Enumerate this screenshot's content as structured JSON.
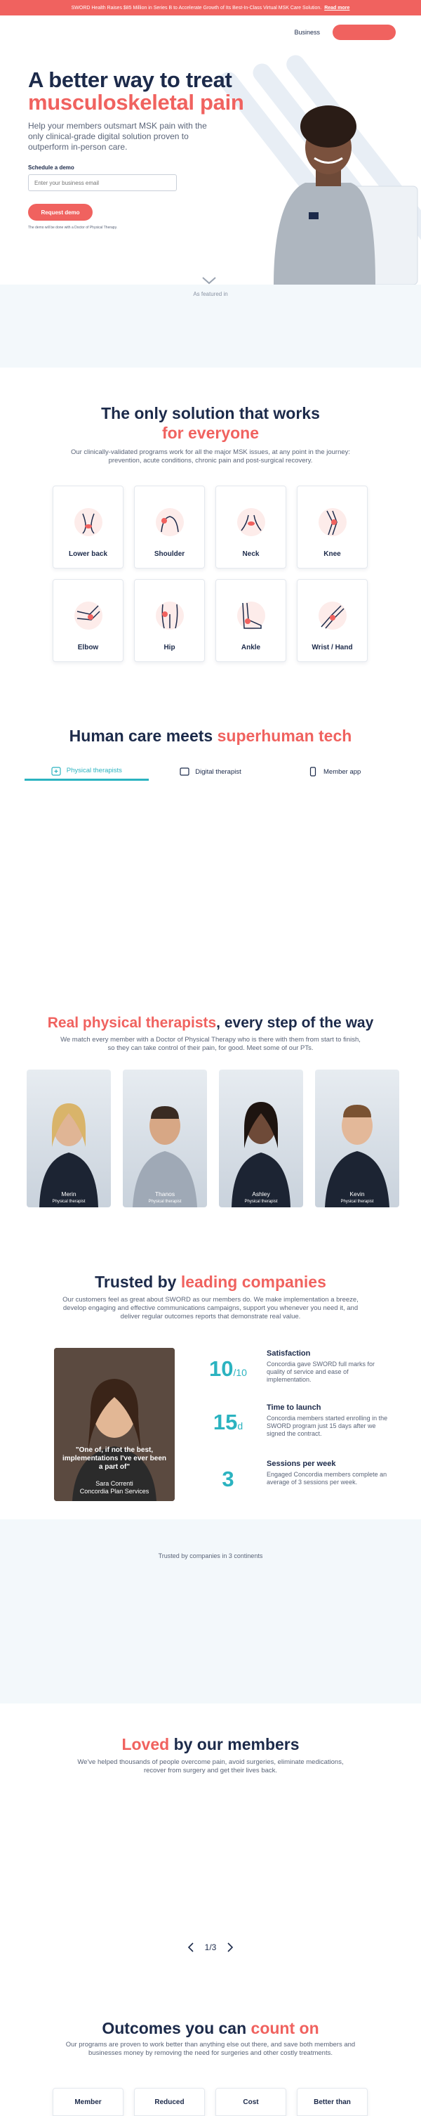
{
  "announcement": {
    "text": "SWORD Health Raises $85 Million in Series B to Accelerate Growth of Its Best-In-Class Virtual MSK Care Solution.",
    "link": "Read more",
    "bg": "#f0625f"
  },
  "header": {
    "business_link": "Business"
  },
  "hero": {
    "title_line1": "A better way to treat",
    "title_line2": "musculoskeletal pain",
    "subtitle": "Help your members outsmart MSK pain with the only clinical-grade digital solution proven to outperform in-person care.",
    "schedule_label": "Schedule a demo",
    "email_placeholder": "Enter your business email",
    "request_button": "Request demo",
    "fine_print": "The demo will be done with a Doctor of Physical Therapy."
  },
  "featured": {
    "label": "As featured in"
  },
  "solution": {
    "title_line1": "The only solution that works",
    "title_line2": "for everyone",
    "subtitle": "Our clinically-validated programs work for all the major MSK issues, at any point in the journey: prevention, acute conditions, chronic pain and post-surgical recovery.",
    "areas": [
      {
        "label": "Lower back",
        "icon": "lower-back-icon"
      },
      {
        "label": "Shoulder",
        "icon": "shoulder-icon"
      },
      {
        "label": "Neck",
        "icon": "neck-icon"
      },
      {
        "label": "Knee",
        "icon": "knee-icon"
      },
      {
        "label": "Elbow",
        "icon": "elbow-icon"
      },
      {
        "label": "Hip",
        "icon": "hip-icon"
      },
      {
        "label": "Ankle",
        "icon": "ankle-icon"
      },
      {
        "label": "Wrist / Hand",
        "icon": "wrist-hand-icon"
      }
    ]
  },
  "human_care": {
    "title_part1": "Human care meets ",
    "title_part2": "superhuman tech",
    "tabs": [
      {
        "label": "Physical therapists",
        "icon": "therapist-icon",
        "active": true
      },
      {
        "label": "Digital therapist",
        "icon": "tablet-icon",
        "active": false
      },
      {
        "label": "Member app",
        "icon": "phone-icon",
        "active": false
      }
    ],
    "accent": "#2bb3c0"
  },
  "therapists": {
    "title_part1": "Real physical therapists",
    "title_part2": ", every step of the way",
    "subtitle": "We match every member with a Doctor of Physical Therapy who is there with them from start to finish, so they can take control of their pain, for good. Meet some of our PTs.",
    "people": [
      {
        "name": "Merin",
        "role": "Physical therapist"
      },
      {
        "name": "Thanos",
        "role": "Physical therapist"
      },
      {
        "name": "Ashley",
        "role": "Physical therapist"
      },
      {
        "name": "Kevin",
        "role": "Physical therapist"
      }
    ]
  },
  "trusted": {
    "title_part1": "Trusted by ",
    "title_part2": "leading companies",
    "subtitle": "Our customers feel as great about SWORD as our members do. We make implementation a breeze, develop engaging and effective communications campaigns, support you whenever you need it, and deliver regular outcomes reports that demonstrate real value.",
    "quote": "\"One of, if not the best, implementations I've ever been a part of\"",
    "quote_name": "Sara Correnti",
    "quote_company": "Concordia Plan Services",
    "stats": [
      {
        "number": "10",
        "suffix": "/10",
        "title": "Satisfaction",
        "text": "Concordia gave SWORD full marks for quality of service and ease of implementation."
      },
      {
        "number": "15",
        "suffix": "d",
        "title": "Time to launch",
        "text": "Concordia members started enrolling in the SWORD program just 15 days after we signed the contract."
      },
      {
        "number": "3",
        "suffix": "",
        "title": "Sessions per week",
        "text": "Engaged Concordia members complete an average of 3 sessions per week."
      }
    ],
    "band_label": "Trusted by companies in 3 continents"
  },
  "members": {
    "title_part1": "Loved",
    "title_part2": " by our members",
    "subtitle": "We've helped thousands of people overcome pain, avoid surgeries, eliminate medications, recover from surgery and get their lives back.",
    "pager": "1/3"
  },
  "outcomes": {
    "title_part1": "Outcomes you can ",
    "title_part2": "count on",
    "subtitle": "Our programs are proven to work better than anything else out there, and save both members and businesses money by removing the need for surgeries and other costly treatments.",
    "cards": [
      "Member",
      "Reduced",
      "Cost",
      "Better than"
    ]
  }
}
